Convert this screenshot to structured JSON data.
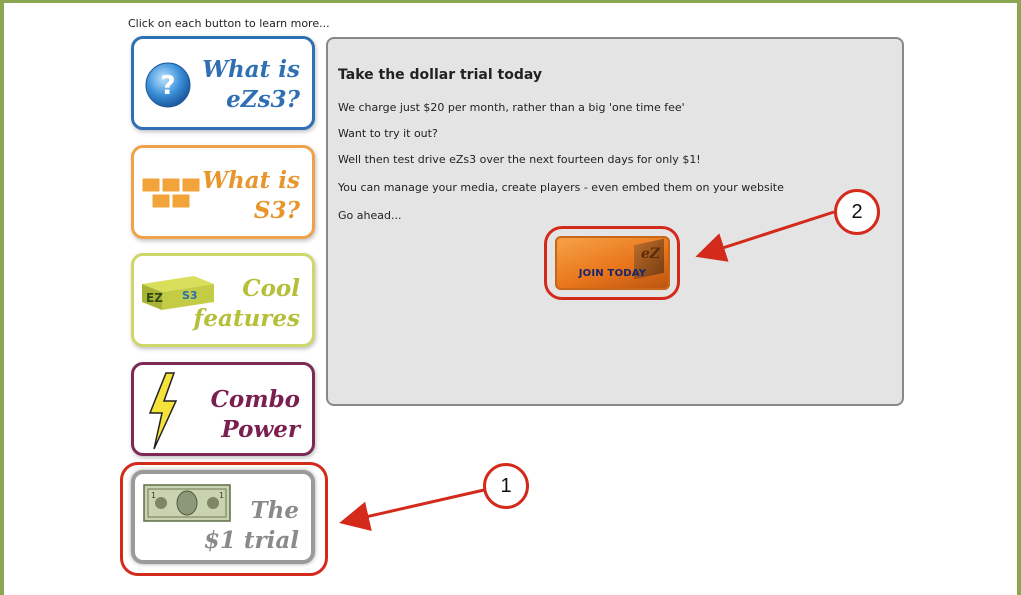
{
  "intro_text": "Click on each button to learn more...",
  "nav_buttons": [
    {
      "line1": "What is",
      "line2": "eZs3?",
      "icon": "question-mark-icon"
    },
    {
      "line1": "What is",
      "line2": "S3?",
      "icon": "boxes-icon"
    },
    {
      "line1": "Cool",
      "line2": "features",
      "icon": "ezs3-logo-cube-icon"
    },
    {
      "line1": "Combo",
      "line2": "Power",
      "icon": "lightning-bolt-icon"
    },
    {
      "line1": "The",
      "line2": "$1 trial",
      "icon": "dollar-bill-icon"
    }
  ],
  "panel": {
    "title": "Take the dollar trial today",
    "lines": [
      "We charge just $20 per month, rather than a big 'one time fee'",
      "Want to try it out?",
      "Well then test drive eZs3 over the next fourteen days for only $1!",
      "You can manage your media, create players - even embed them on your website",
      "Go ahead..."
    ],
    "join_button": {
      "label": "JOIN TODAY",
      "logo_text": "eZ"
    }
  },
  "annotations": {
    "callout1": "1",
    "callout2": "2",
    "color": "#d32a1c"
  }
}
